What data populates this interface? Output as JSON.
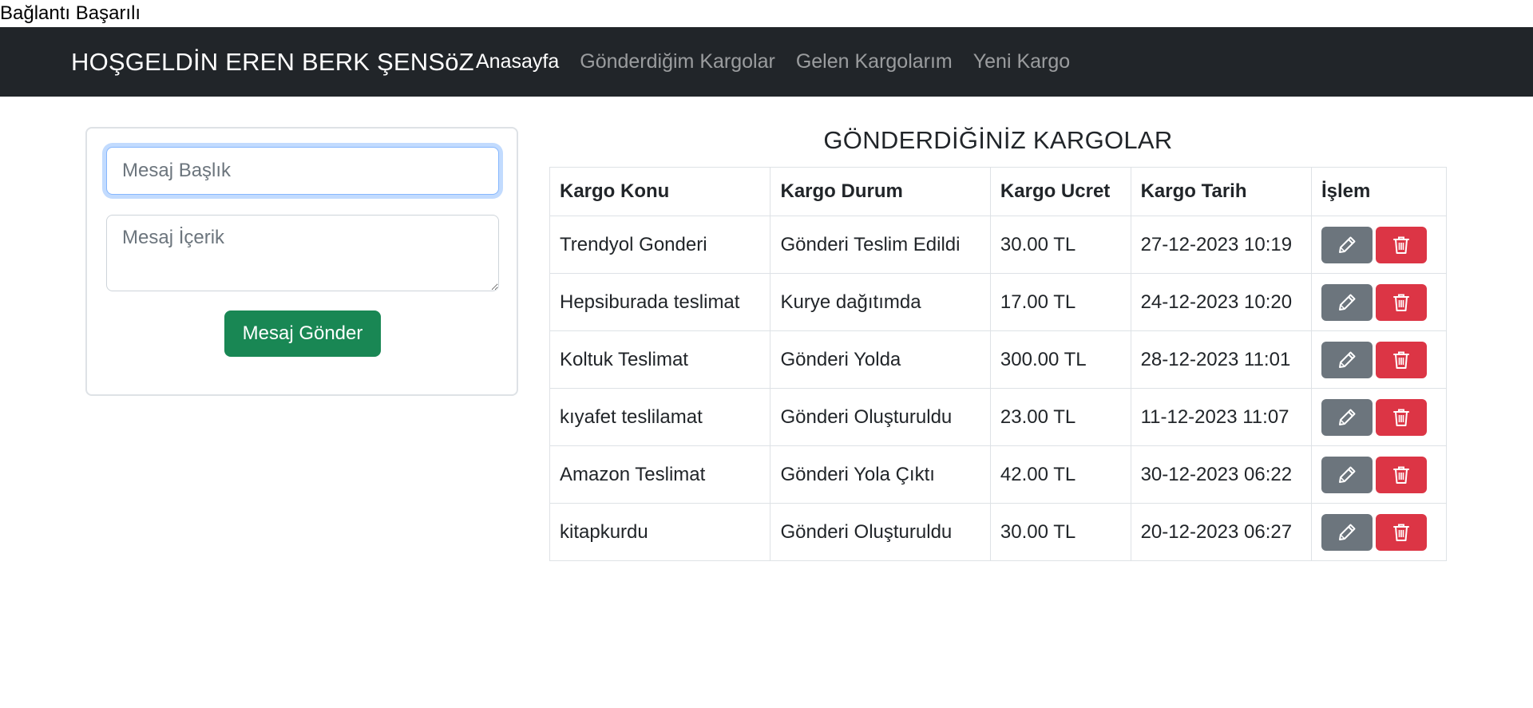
{
  "status": "Bağlantı Başarılı",
  "navbar": {
    "brand": "HOŞGELDİN EREN BERK ŞENSöZ",
    "links": [
      {
        "label": "Anasayfa",
        "active": true
      },
      {
        "label": "Gönderdiğim Kargolar",
        "active": false
      },
      {
        "label": "Gelen Kargolarım",
        "active": false
      },
      {
        "label": "Yeni Kargo",
        "active": false
      }
    ]
  },
  "message_form": {
    "title_placeholder": "Mesaj Başlık",
    "title_value": "",
    "body_placeholder": "Mesaj İçerik",
    "body_value": "",
    "send_label": "Mesaj Gönder"
  },
  "table": {
    "title": "GÖNDERDİĞİNİZ KARGOLAR",
    "columns": [
      "Kargo Konu",
      "Kargo Durum",
      "Kargo Ucret",
      "Kargo Tarih",
      "İşlem"
    ],
    "rows": [
      {
        "konu": "Trendyol Gonderi",
        "durum": "Gönderi Teslim Edildi",
        "ucret": "30.00 TL",
        "tarih": "27-12-2023 10:19"
      },
      {
        "konu": "Hepsiburada teslimat",
        "durum": "Kurye dağıtımda",
        "ucret": "17.00 TL",
        "tarih": "24-12-2023 10:20"
      },
      {
        "konu": "Koltuk Teslimat",
        "durum": "Gönderi Yolda",
        "ucret": "300.00 TL",
        "tarih": "28-12-2023 11:01"
      },
      {
        "konu": "kıyafet teslilamat",
        "durum": "Gönderi Oluşturuldu",
        "ucret": "23.00 TL",
        "tarih": "11-12-2023 11:07"
      },
      {
        "konu": "Amazon Teslimat",
        "durum": "Gönderi Yola Çıktı",
        "ucret": "42.00 TL",
        "tarih": "30-12-2023 06:22"
      },
      {
        "konu": "kitapkurdu",
        "durum": "Gönderi Oluşturuldu",
        "ucret": "30.00 TL",
        "tarih": "20-12-2023 06:27"
      }
    ],
    "row_actions": {
      "edit_icon": "pen-icon",
      "delete_icon": "trash-icon"
    }
  },
  "colors": {
    "navbar_bg": "#212529",
    "send_button": "#198754",
    "edit_button": "#6c757d",
    "delete_button": "#dc3545"
  }
}
